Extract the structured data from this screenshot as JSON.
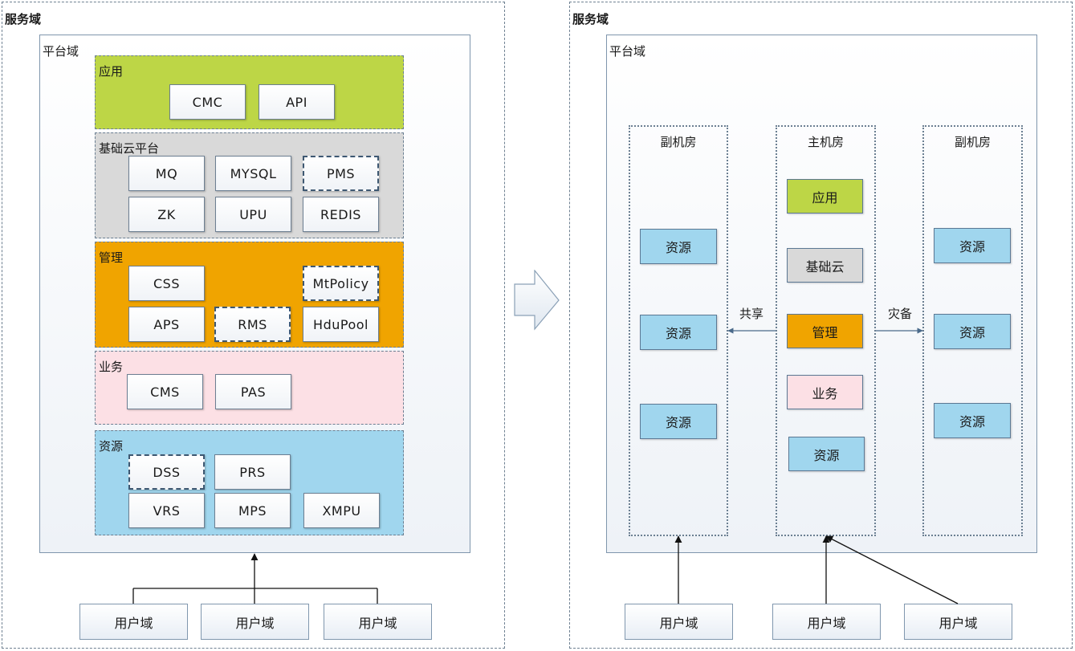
{
  "colors": {
    "app": "#bdd646",
    "base_cloud": "#d9d9d9",
    "management": "#f0a400",
    "business": "#fce0e5",
    "resource": "#a0d6ee"
  },
  "left": {
    "service_title": "服务域",
    "platform_title": "平台域",
    "layers": {
      "app": {
        "title": "应用",
        "modules": [
          "CMC",
          "API"
        ]
      },
      "base": {
        "title": "基础云平台",
        "modules": [
          "MQ",
          "MYSQL",
          "PMS",
          "ZK",
          "UPU",
          "REDIS"
        ]
      },
      "mgmt": {
        "title": "管理",
        "modules": [
          "CSS",
          "MtPolicy",
          "APS",
          "RMS",
          "HduPool"
        ]
      },
      "biz": {
        "title": "业务",
        "modules": [
          "CMS",
          "PAS"
        ]
      },
      "res": {
        "title": "资源",
        "modules": [
          "DSS",
          "PRS",
          "VRS",
          "MPS",
          "XMPU"
        ]
      }
    },
    "users": [
      "用户域",
      "用户域",
      "用户域"
    ]
  },
  "arrow_icon": "right-block-arrow-icon",
  "right": {
    "service_title": "服务域",
    "platform_title": "平台域",
    "rooms": {
      "left": {
        "title": "副机房",
        "items": [
          "资源",
          "资源",
          "资源"
        ]
      },
      "main": {
        "title": "主机房",
        "items": [
          "应用",
          "基础云",
          "管理",
          "业务",
          "资源"
        ]
      },
      "right": {
        "title": "副机房",
        "items": [
          "资源",
          "资源",
          "资源"
        ]
      }
    },
    "edges": {
      "share": "共享",
      "backup": "灾备"
    },
    "users": [
      "用户域",
      "用户域",
      "用户域"
    ]
  }
}
